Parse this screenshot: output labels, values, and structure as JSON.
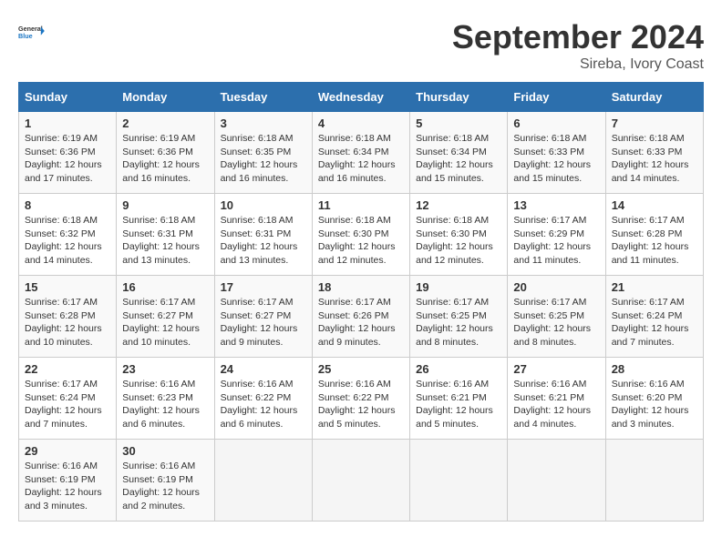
{
  "logo": {
    "line1": "General",
    "line2": "Blue"
  },
  "title": "September 2024",
  "location": "Sireba, Ivory Coast",
  "days_of_week": [
    "Sunday",
    "Monday",
    "Tuesday",
    "Wednesday",
    "Thursday",
    "Friday",
    "Saturday"
  ],
  "weeks": [
    [
      {
        "day": "1",
        "sunrise": "6:19 AM",
        "sunset": "6:36 PM",
        "daylight": "12 hours and 17 minutes."
      },
      {
        "day": "2",
        "sunrise": "6:19 AM",
        "sunset": "6:36 PM",
        "daylight": "12 hours and 16 minutes."
      },
      {
        "day": "3",
        "sunrise": "6:18 AM",
        "sunset": "6:35 PM",
        "daylight": "12 hours and 16 minutes."
      },
      {
        "day": "4",
        "sunrise": "6:18 AM",
        "sunset": "6:34 PM",
        "daylight": "12 hours and 16 minutes."
      },
      {
        "day": "5",
        "sunrise": "6:18 AM",
        "sunset": "6:34 PM",
        "daylight": "12 hours and 15 minutes."
      },
      {
        "day": "6",
        "sunrise": "6:18 AM",
        "sunset": "6:33 PM",
        "daylight": "12 hours and 15 minutes."
      },
      {
        "day": "7",
        "sunrise": "6:18 AM",
        "sunset": "6:33 PM",
        "daylight": "12 hours and 14 minutes."
      }
    ],
    [
      {
        "day": "8",
        "sunrise": "6:18 AM",
        "sunset": "6:32 PM",
        "daylight": "12 hours and 14 minutes."
      },
      {
        "day": "9",
        "sunrise": "6:18 AM",
        "sunset": "6:31 PM",
        "daylight": "12 hours and 13 minutes."
      },
      {
        "day": "10",
        "sunrise": "6:18 AM",
        "sunset": "6:31 PM",
        "daylight": "12 hours and 13 minutes."
      },
      {
        "day": "11",
        "sunrise": "6:18 AM",
        "sunset": "6:30 PM",
        "daylight": "12 hours and 12 minutes."
      },
      {
        "day": "12",
        "sunrise": "6:18 AM",
        "sunset": "6:30 PM",
        "daylight": "12 hours and 12 minutes."
      },
      {
        "day": "13",
        "sunrise": "6:17 AM",
        "sunset": "6:29 PM",
        "daylight": "12 hours and 11 minutes."
      },
      {
        "day": "14",
        "sunrise": "6:17 AM",
        "sunset": "6:28 PM",
        "daylight": "12 hours and 11 minutes."
      }
    ],
    [
      {
        "day": "15",
        "sunrise": "6:17 AM",
        "sunset": "6:28 PM",
        "daylight": "12 hours and 10 minutes."
      },
      {
        "day": "16",
        "sunrise": "6:17 AM",
        "sunset": "6:27 PM",
        "daylight": "12 hours and 10 minutes."
      },
      {
        "day": "17",
        "sunrise": "6:17 AM",
        "sunset": "6:27 PM",
        "daylight": "12 hours and 9 minutes."
      },
      {
        "day": "18",
        "sunrise": "6:17 AM",
        "sunset": "6:26 PM",
        "daylight": "12 hours and 9 minutes."
      },
      {
        "day": "19",
        "sunrise": "6:17 AM",
        "sunset": "6:25 PM",
        "daylight": "12 hours and 8 minutes."
      },
      {
        "day": "20",
        "sunrise": "6:17 AM",
        "sunset": "6:25 PM",
        "daylight": "12 hours and 8 minutes."
      },
      {
        "day": "21",
        "sunrise": "6:17 AM",
        "sunset": "6:24 PM",
        "daylight": "12 hours and 7 minutes."
      }
    ],
    [
      {
        "day": "22",
        "sunrise": "6:17 AM",
        "sunset": "6:24 PM",
        "daylight": "12 hours and 7 minutes."
      },
      {
        "day": "23",
        "sunrise": "6:16 AM",
        "sunset": "6:23 PM",
        "daylight": "12 hours and 6 minutes."
      },
      {
        "day": "24",
        "sunrise": "6:16 AM",
        "sunset": "6:22 PM",
        "daylight": "12 hours and 6 minutes."
      },
      {
        "day": "25",
        "sunrise": "6:16 AM",
        "sunset": "6:22 PM",
        "daylight": "12 hours and 5 minutes."
      },
      {
        "day": "26",
        "sunrise": "6:16 AM",
        "sunset": "6:21 PM",
        "daylight": "12 hours and 5 minutes."
      },
      {
        "day": "27",
        "sunrise": "6:16 AM",
        "sunset": "6:21 PM",
        "daylight": "12 hours and 4 minutes."
      },
      {
        "day": "28",
        "sunrise": "6:16 AM",
        "sunset": "6:20 PM",
        "daylight": "12 hours and 3 minutes."
      }
    ],
    [
      {
        "day": "29",
        "sunrise": "6:16 AM",
        "sunset": "6:19 PM",
        "daylight": "12 hours and 3 minutes."
      },
      {
        "day": "30",
        "sunrise": "6:16 AM",
        "sunset": "6:19 PM",
        "daylight": "12 hours and 2 minutes."
      },
      null,
      null,
      null,
      null,
      null
    ]
  ]
}
